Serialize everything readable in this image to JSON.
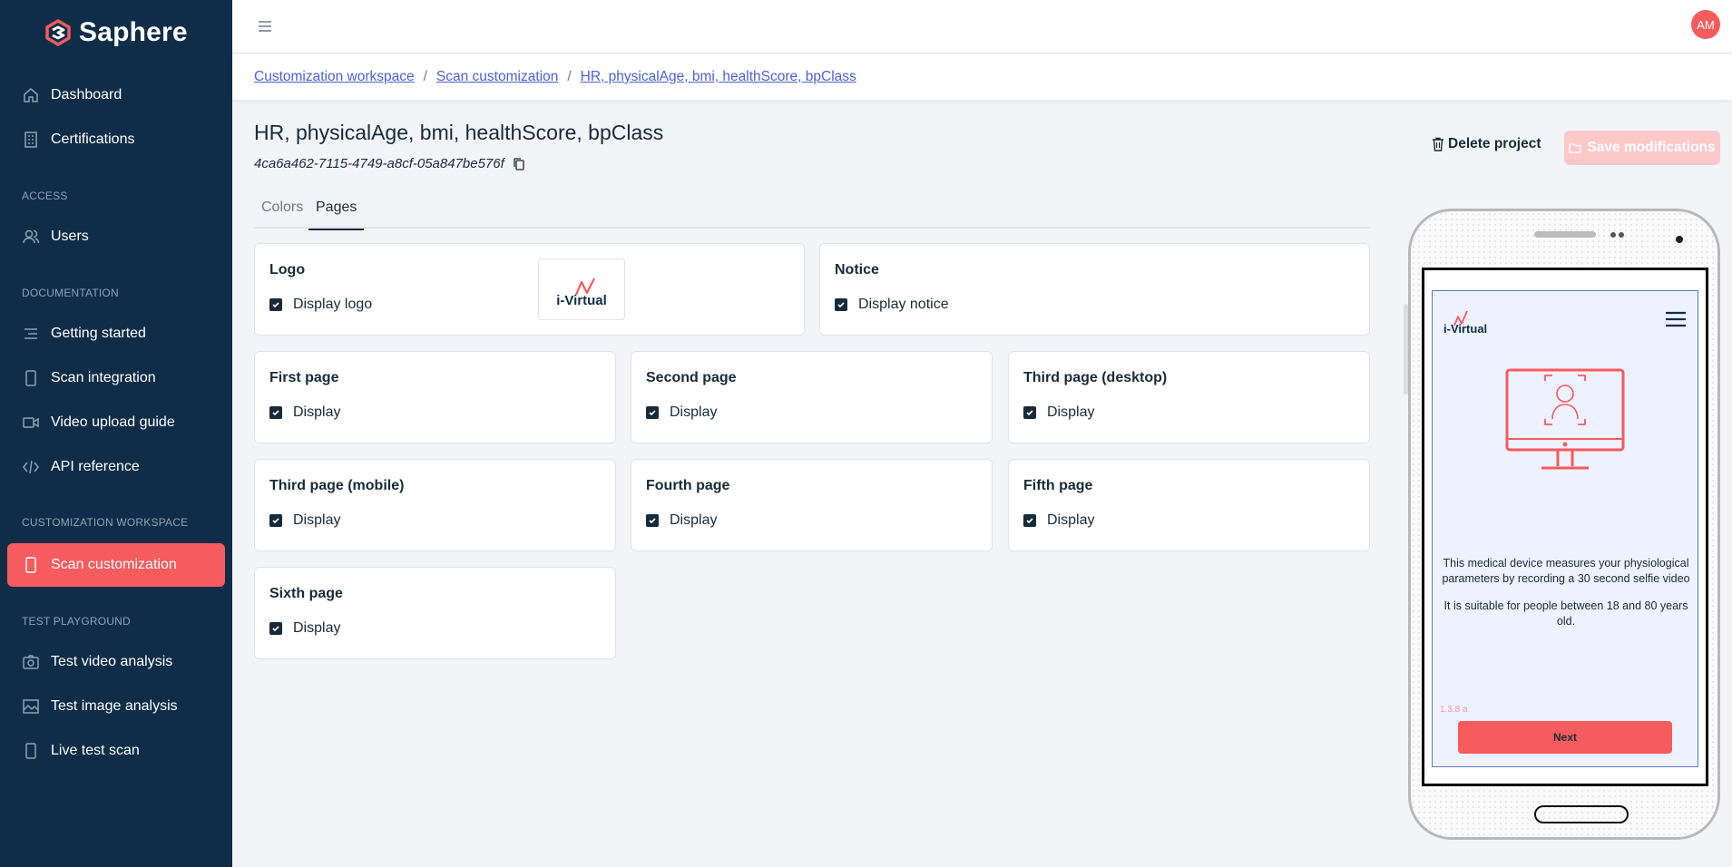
{
  "brand": {
    "name": "Saphere",
    "accent": "#f65b5e",
    "sidebar_bg": "#0f2d48"
  },
  "sidebar": {
    "items_top": [
      {
        "label": "Dashboard",
        "icon": "home-icon"
      },
      {
        "label": "Certifications",
        "icon": "building-icon"
      }
    ],
    "section_access": "ACCESS",
    "items_access": [
      {
        "label": "Users",
        "icon": "users-icon"
      }
    ],
    "section_documentation": "DOCUMENTATION",
    "items_documentation": [
      {
        "label": "Getting started",
        "icon": "lines-icon"
      },
      {
        "label": "Scan integration",
        "icon": "phone-icon"
      },
      {
        "label": "Video upload guide",
        "icon": "video-icon"
      },
      {
        "label": "API reference",
        "icon": "code-icon"
      }
    ],
    "section_customization": "CUSTOMIZATION WORKSPACE",
    "items_customization": [
      {
        "label": "Scan customization",
        "icon": "phone-icon",
        "active": true
      }
    ],
    "section_test": "TEST PLAYGROUND",
    "items_test": [
      {
        "label": "Test video analysis",
        "icon": "camera-icon"
      },
      {
        "label": "Test image analysis",
        "icon": "image-icon"
      },
      {
        "label": "Live test scan",
        "icon": "phone-icon"
      }
    ]
  },
  "topbar": {
    "avatar_initials": "AM"
  },
  "breadcrumb": [
    "Customization workspace",
    "Scan customization",
    "HR, physicalAge, bmi, healthScore, bpClass"
  ],
  "breadcrumb_sep": "/",
  "project": {
    "title": "HR, physicalAge, bmi, healthScore, bpClass",
    "id": "4ca6a462-7115-4749-a8cf-05a847be576f",
    "delete_label": "Delete project",
    "save_label": "Save modifications"
  },
  "tabs": [
    {
      "label": "Colors",
      "active": false
    },
    {
      "label": "Pages",
      "active": true
    }
  ],
  "cards": {
    "logo": {
      "title": "Logo",
      "check_label": "Display logo",
      "checked": true
    },
    "notice": {
      "title": "Notice",
      "check_label": "Display notice",
      "checked": true
    },
    "pages": [
      {
        "title": "First page",
        "check_label": "Display",
        "checked": true
      },
      {
        "title": "Second page",
        "check_label": "Display",
        "checked": true
      },
      {
        "title": "Third page (desktop)",
        "check_label": "Display",
        "checked": true
      },
      {
        "title": "Third page (mobile)",
        "check_label": "Display",
        "checked": true
      },
      {
        "title": "Fourth page",
        "check_label": "Display",
        "checked": true
      },
      {
        "title": "Fifth page",
        "check_label": "Display",
        "checked": true
      },
      {
        "title": "Sixth page",
        "check_label": "Display",
        "checked": true
      }
    ]
  },
  "preview": {
    "logo_text": "i-Virtual",
    "text1": "This medical device measures your physiological parameters by recording a 30 second selfie video",
    "text2": "It is suitable for people between 18 and 80 years old.",
    "version": "1.3.8 a",
    "next_label": "Next"
  }
}
